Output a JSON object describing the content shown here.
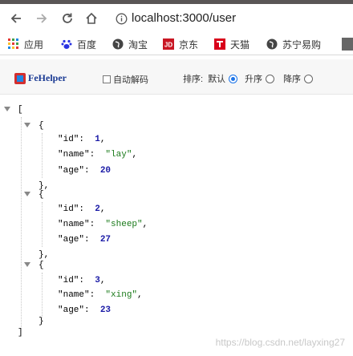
{
  "browser": {
    "url": "localhost:3000/user",
    "icons": {
      "back": "back-arrow-icon",
      "forward": "forward-arrow-icon",
      "reload": "reload-icon",
      "home": "home-icon",
      "info": "info-icon"
    }
  },
  "bookmarks": [
    {
      "label": "应用",
      "icon": "apps-grid-icon"
    },
    {
      "label": "百度",
      "icon": "baidu-paw-icon"
    },
    {
      "label": "淘宝",
      "icon": "globe-icon"
    },
    {
      "label": "京东",
      "icon": "jd-logo-icon"
    },
    {
      "label": "天猫",
      "icon": "tmall-logo-icon"
    },
    {
      "label": "苏宁易购",
      "icon": "globe-icon"
    }
  ],
  "fehelper": {
    "logo_text": "FeHelper",
    "auto_decode_label": "自动解码",
    "sort_label": "排序:",
    "default_label": "默认",
    "asc_label": "升序",
    "desc_label": "降序",
    "selected": "默认"
  },
  "json": {
    "open_bracket": "[",
    "close_bracket": "]",
    "items": [
      {
        "id": "1",
        "name": "\"lay\"",
        "age": "20"
      },
      {
        "id": "2",
        "name": "\"sheep\"",
        "age": "27"
      },
      {
        "id": "3",
        "name": "\"xing\"",
        "age": "23"
      }
    ],
    "keys": {
      "id": "\"id\":",
      "name": "\"name\":",
      "age": "\"age\":"
    }
  },
  "watermark": "https://blog.csdn.net/layxing27"
}
